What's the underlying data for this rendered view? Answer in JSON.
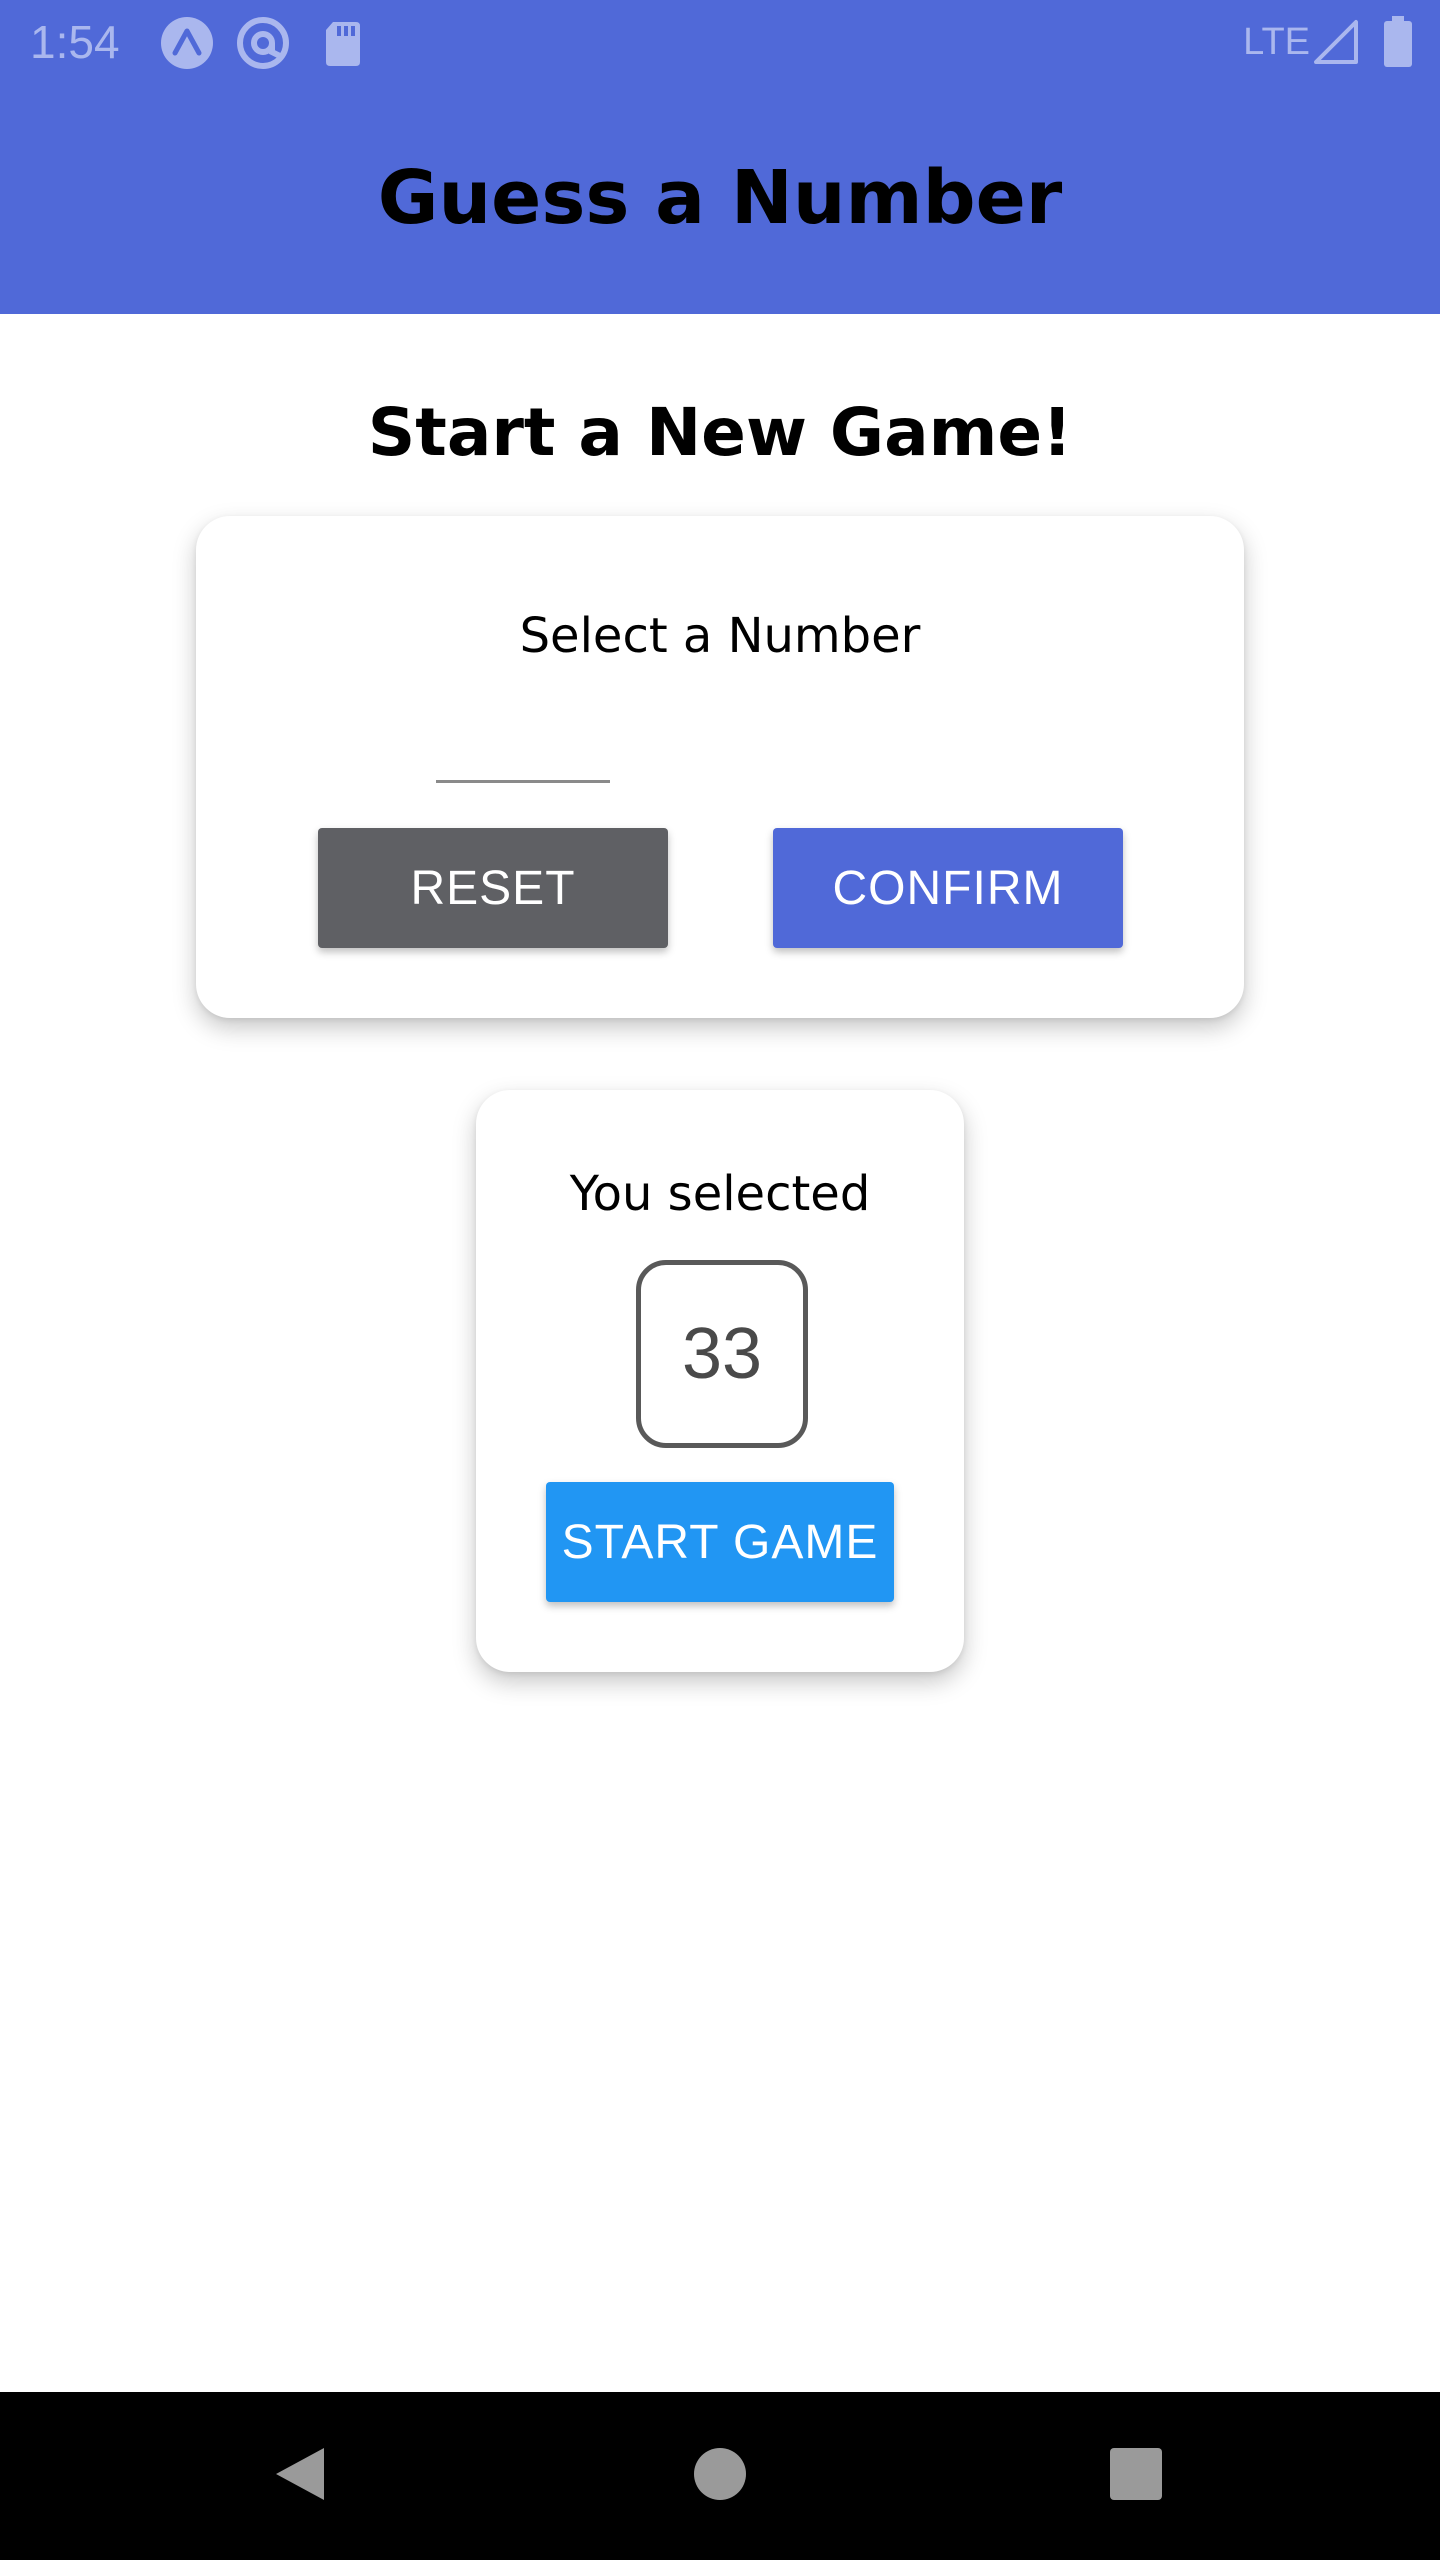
{
  "status_bar": {
    "time": "1:54",
    "network": "LTE",
    "icons": [
      "expo-icon",
      "at-sign-icon",
      "sd-card-icon",
      "signal-icon",
      "battery-icon"
    ]
  },
  "header": {
    "title": "Guess a Number"
  },
  "main": {
    "title": "Start a New Game!",
    "input_card": {
      "label": "Select a Number",
      "input_value": "",
      "reset_label": "RESET",
      "confirm_label": "CONFIRM"
    },
    "result_card": {
      "label": "You selected",
      "selected_number": "33",
      "start_label": "START GAME"
    }
  },
  "nav_bar": {
    "icons": [
      "back-icon",
      "home-icon",
      "recents-icon"
    ]
  },
  "colors": {
    "header": "#5069d8",
    "reset_button": "#5f6064",
    "confirm_button": "#5069d8",
    "start_button": "#2196f3"
  }
}
